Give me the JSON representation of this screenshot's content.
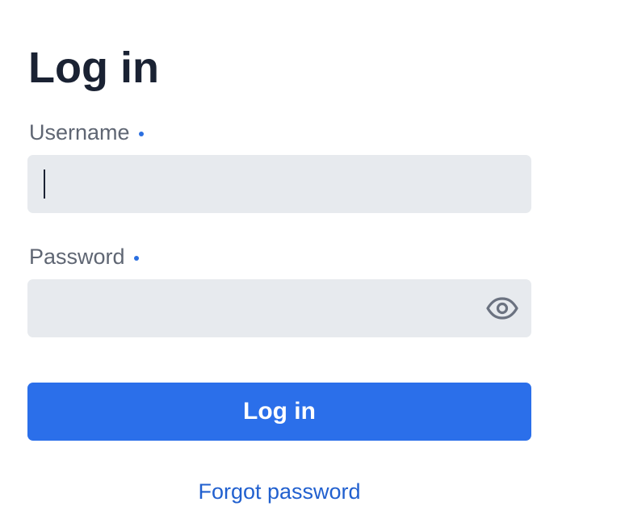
{
  "page": {
    "title": "Log in"
  },
  "form": {
    "username": {
      "label": "Username",
      "value": "",
      "placeholder": ""
    },
    "password": {
      "label": "Password",
      "value": "",
      "placeholder": "",
      "toggle_icon": "eye-icon"
    },
    "submit_label": "Log in",
    "forgot_label": "Forgot password"
  },
  "colors": {
    "heading": "#1a2233",
    "label": "#5f6673",
    "required_dot": "#2b6fe0",
    "input_bg": "#e7eaee",
    "primary": "#2b6fea",
    "link": "#2160cf"
  }
}
